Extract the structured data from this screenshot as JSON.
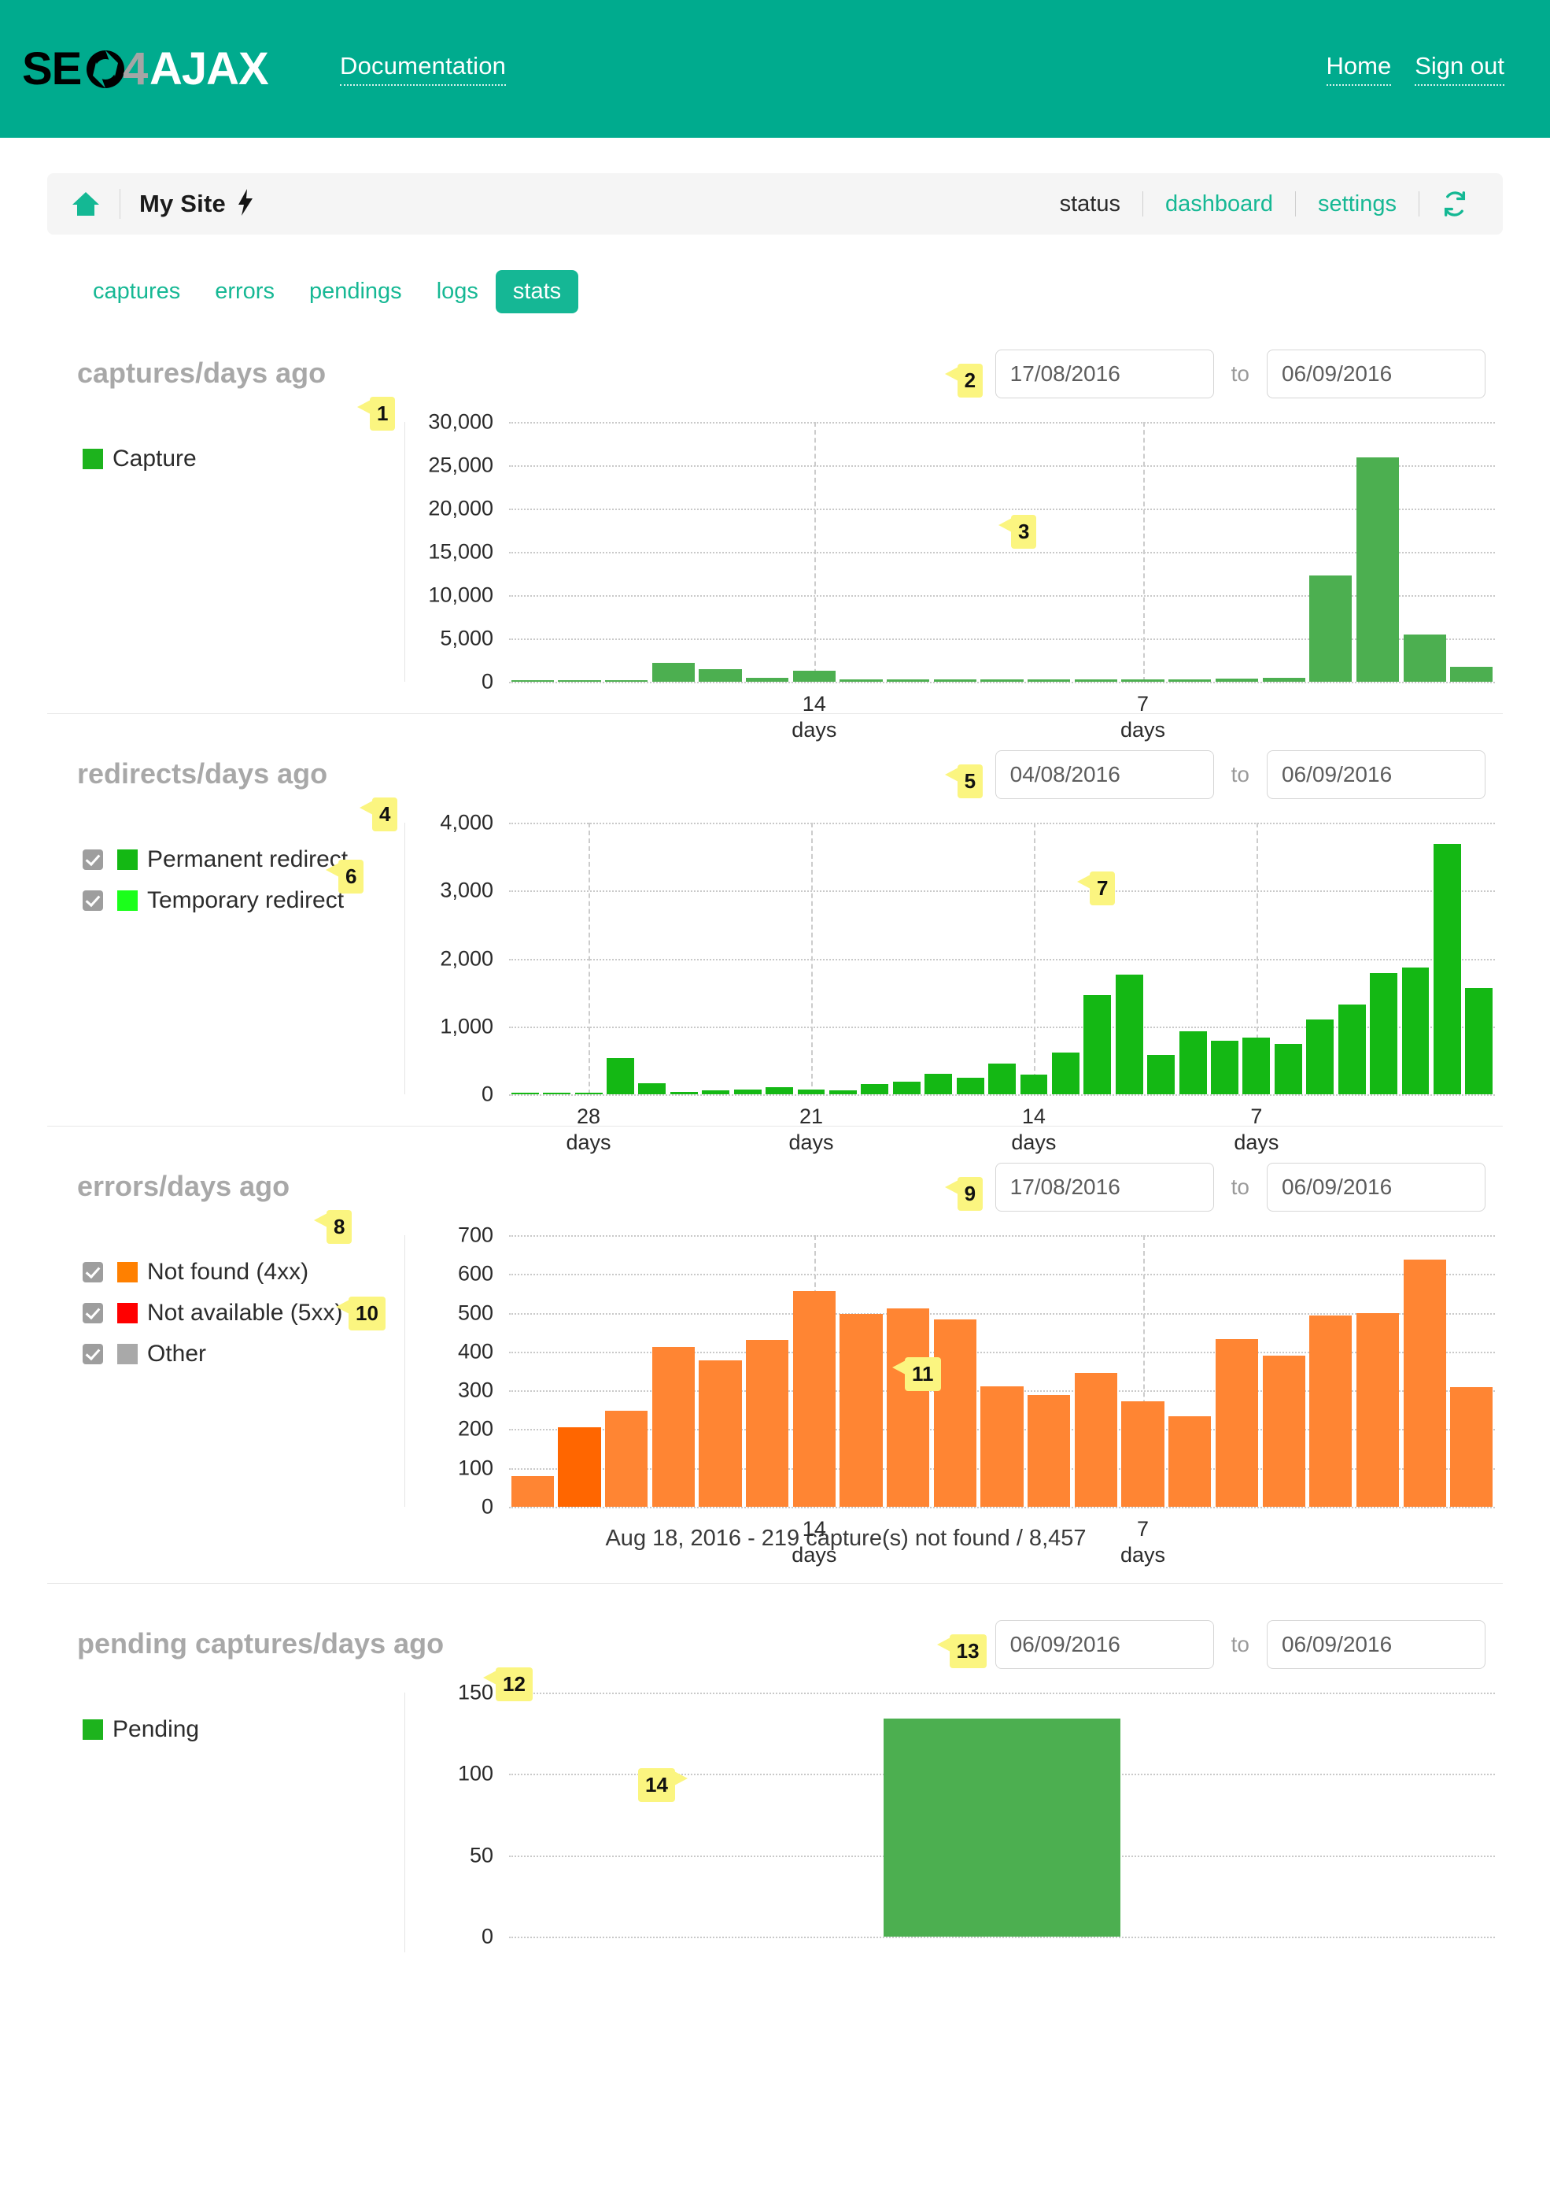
{
  "header": {
    "logo_text": "SEO4AJAX",
    "logo_parts": {
      "seo": "SEO",
      "four": "4",
      "ajax": "AJAX"
    },
    "documentation_label": "Documentation",
    "home_label": "Home",
    "signout_label": "Sign out",
    "brand_color": "#00ab8e"
  },
  "sitebar": {
    "home_icon": "home-icon",
    "site_name": "My Site",
    "bolt_icon": "bolt-icon",
    "links": [
      {
        "label": "status",
        "active": true
      },
      {
        "label": "dashboard",
        "active": false
      },
      {
        "label": "settings",
        "active": false
      }
    ],
    "refresh_icon": "refresh-icon"
  },
  "tabs": [
    {
      "label": "captures",
      "active": false
    },
    {
      "label": "errors",
      "active": false
    },
    {
      "label": "pendings",
      "active": false
    },
    {
      "label": "logs",
      "active": false
    },
    {
      "label": "stats",
      "active": true
    }
  ],
  "to_label": "to",
  "markers": {
    "m1": "1",
    "m2": "2",
    "m3": "3",
    "m4": "4",
    "m5": "5",
    "m6": "6",
    "m7": "7",
    "m8": "8",
    "m9": "9",
    "m10": "10",
    "m11": "11",
    "m12": "12",
    "m13": "13",
    "m14": "14"
  },
  "sections": [
    {
      "title": "captures/days ago",
      "date_from": "17/08/2016",
      "date_to": "06/09/2016",
      "legend": [
        {
          "label": "Capture",
          "color": "#1db31d",
          "checkbox": false
        }
      ]
    },
    {
      "title": "redirects/days ago",
      "date_from": "04/08/2016",
      "date_to": "06/09/2016",
      "legend": [
        {
          "label": "Permanent redirect",
          "color": "#14b814",
          "checkbox": true
        },
        {
          "label": "Temporary redirect",
          "color": "#1bff1b",
          "checkbox": true
        }
      ]
    },
    {
      "title": "errors/days ago",
      "date_from": "17/08/2016",
      "date_to": "06/09/2016",
      "legend": [
        {
          "label": "Not found (4xx)",
          "color": "#ff8000",
          "checkbox": true
        },
        {
          "label": "Not available (5xx)",
          "color": "#ff0000",
          "checkbox": true
        },
        {
          "label": "Other",
          "color": "#a9a9a9",
          "checkbox": true
        }
      ],
      "caption": "Aug 18, 2016 - 219 capture(s) not found / 8,457"
    },
    {
      "title": "pending captures/days ago",
      "date_from": "06/09/2016",
      "date_to": "06/09/2016",
      "legend": [
        {
          "label": "Pending",
          "color": "#1db31d",
          "checkbox": false
        }
      ]
    }
  ],
  "chart_data": [
    {
      "id": "captures",
      "type": "bar",
      "title": "captures/days ago",
      "xlabel": "days ago",
      "ylabel": "",
      "ylim": [
        0,
        30000
      ],
      "yticks": [
        0,
        5000,
        10000,
        15000,
        20000,
        25000,
        30000
      ],
      "ytick_labels": [
        "0",
        "5,000",
        "10,000",
        "15,000",
        "20,000",
        "25,000",
        "30,000"
      ],
      "xtick_positions": [
        14,
        7
      ],
      "xtick_labels": [
        "14\ndays",
        "7\ndays"
      ],
      "grid": true,
      "legend": [
        "Capture"
      ],
      "colors": [
        "#4caf50"
      ],
      "series": [
        {
          "name": "Capture",
          "values": [
            0,
            0,
            0,
            2150,
            1480,
            460,
            1300,
            60,
            70,
            130,
            90,
            130,
            190,
            120,
            150,
            320,
            500,
            12300,
            25900,
            5450,
            1750
          ]
        }
      ]
    },
    {
      "id": "redirects",
      "type": "bar",
      "title": "redirects/days ago",
      "xlabel": "days ago",
      "ylabel": "",
      "ylim": [
        0,
        4000
      ],
      "yticks": [
        0,
        1000,
        2000,
        3000,
        4000
      ],
      "ytick_labels": [
        "0",
        "1,000",
        "2,000",
        "3,000",
        "4,000"
      ],
      "xtick_positions": [
        28,
        21,
        14,
        7
      ],
      "xtick_labels": [
        "28\ndays",
        "21\ndays",
        "14\ndays",
        "7\ndays"
      ],
      "grid": true,
      "legend": [
        "Permanent redirect",
        "Temporary redirect"
      ],
      "colors": [
        "#14b814",
        "#1bff1b"
      ],
      "series": [
        {
          "name": "Temporary redirect",
          "values": [
            0,
            0,
            0,
            530,
            160,
            40,
            55,
            75,
            105,
            70,
            60,
            150,
            190,
            300,
            240,
            450,
            290,
            620,
            1460,
            1760,
            580,
            930,
            790,
            840,
            740,
            1100,
            1320,
            1780,
            1870,
            3690,
            1560
          ]
        }
      ]
    },
    {
      "id": "errors",
      "type": "bar",
      "title": "errors/days ago",
      "xlabel": "days ago",
      "ylabel": "",
      "ylim": [
        0,
        700
      ],
      "yticks": [
        0,
        100,
        200,
        300,
        400,
        500,
        600,
        700
      ],
      "ytick_labels": [
        "0",
        "100",
        "200",
        "300",
        "400",
        "500",
        "600",
        "700"
      ],
      "xtick_positions": [
        14,
        7
      ],
      "xtick_labels": [
        "14\ndays",
        "7\ndays"
      ],
      "grid": true,
      "legend": [
        "Not found (4xx)",
        "Not available (5xx)",
        "Other"
      ],
      "colors": [
        "#ff8533",
        "#ff0000",
        "#a9a9a9"
      ],
      "highlight_index": 1,
      "highlight_color": "#ff6600",
      "annotation": "Aug 18, 2016 - 219 capture(s) not found / 8,457",
      "series": [
        {
          "name": "Not found (4xx)",
          "values": [
            80,
            205,
            248,
            412,
            378,
            430,
            555,
            497,
            512,
            483,
            310,
            288,
            345,
            272,
            233,
            432,
            390,
            493,
            500,
            638,
            309
          ]
        }
      ]
    },
    {
      "id": "pending",
      "type": "bar",
      "title": "pending captures/days ago",
      "xlabel": "",
      "ylabel": "",
      "ylim": [
        0,
        150
      ],
      "yticks": [
        0,
        50,
        100,
        150
      ],
      "ytick_labels": [
        "0",
        "50",
        "100",
        "150"
      ],
      "grid": true,
      "legend": [
        "Pending"
      ],
      "colors": [
        "#4caf50"
      ],
      "series": [
        {
          "name": "Pending",
          "values": [
            134
          ]
        }
      ]
    }
  ]
}
